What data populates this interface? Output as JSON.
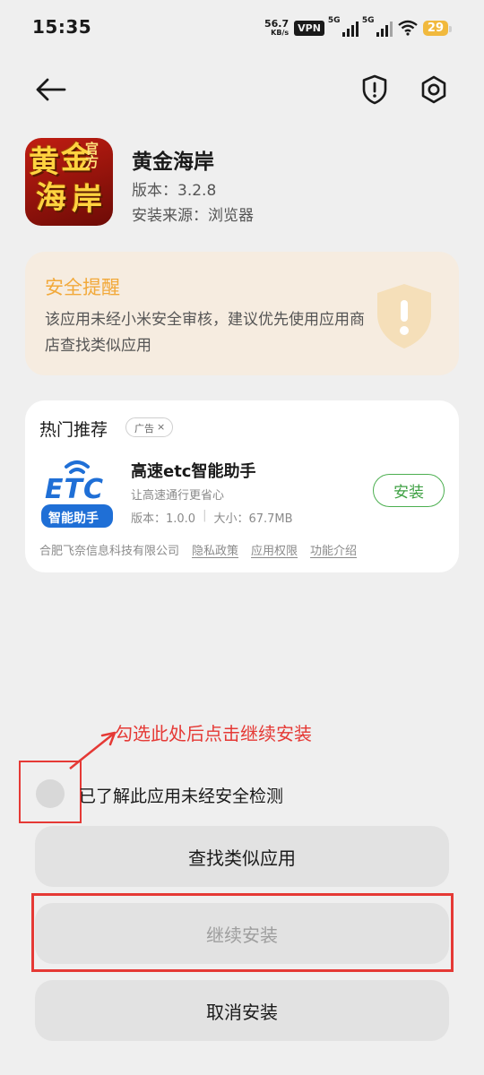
{
  "status_bar": {
    "time": "15:35",
    "net_speed": "56.7",
    "net_unit": "KB/s",
    "vpn": "VPN",
    "sim1_label": "5G",
    "sim2_label": "5G",
    "battery": "29"
  },
  "header": {
    "back_icon": "arrow-left-icon",
    "shield_icon": "shield-alert-icon",
    "settings_icon": "gear-icon"
  },
  "app": {
    "icon_text": [
      "黄",
      "金",
      "海",
      "岸"
    ],
    "icon_badge": "官方",
    "name": "黄金海岸",
    "version": "版本：3.2.8",
    "source": "安装来源：浏览器"
  },
  "warning": {
    "title": "安全提醒",
    "text": "该应用未经小米安全审核，建议优先使用应用商店查找类似应用",
    "accent": "#f2a93a"
  },
  "recommend": {
    "title": "热门推荐",
    "ad_label": "广告",
    "ad_close": "×",
    "app_icon_text": "ETC",
    "app_icon_caption": "智能助手",
    "app_name": "高速etc智能助手",
    "app_desc": "让高速通行更省心",
    "app_version": "版本：1.0.0",
    "app_size": "大小：67.7MB",
    "install_label": "安装",
    "developer": "合肥飞奈信息科技有限公司",
    "privacy": "隐私政策",
    "permissions": "应用权限",
    "features": "功能介绍"
  },
  "annotation": {
    "text": "勾选此处后点击继续安装",
    "color": "#e53935"
  },
  "consent": {
    "label": "已了解此应用未经安全检测"
  },
  "buttons": {
    "find_similar": "查找类似应用",
    "continue_install": "继续安装",
    "cancel_install": "取消安装"
  }
}
